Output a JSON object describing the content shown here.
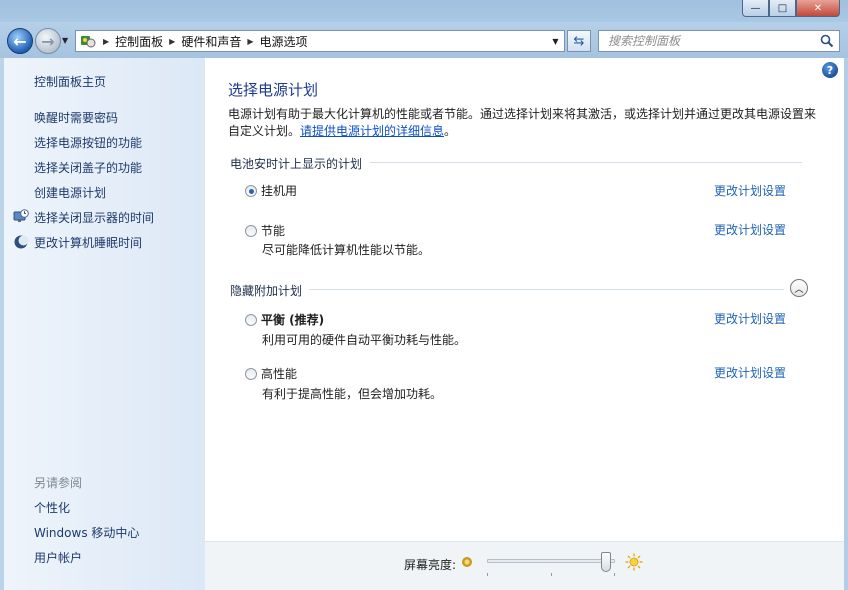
{
  "window": {
    "buttons": {
      "minimize": "—",
      "maximize": "□",
      "close": "✕"
    }
  },
  "nav": {
    "back": "←",
    "forward": "→",
    "breadcrumb": [
      "控制面板",
      "硬件和声音",
      "电源选项"
    ],
    "search_placeholder": "搜索控制面板"
  },
  "sidebar": {
    "home": "控制面板主页",
    "tasks": [
      {
        "label": "唤醒时需要密码",
        "icon": null
      },
      {
        "label": "选择电源按钮的功能",
        "icon": null
      },
      {
        "label": "选择关闭盖子的功能",
        "icon": null
      },
      {
        "label": "创建电源计划",
        "icon": null
      },
      {
        "label": "选择关闭显示器的时间",
        "icon": "monitor-clock-icon"
      },
      {
        "label": "更改计算机睡眠时间",
        "icon": "moon-icon"
      }
    ],
    "see_also_title": "另请参阅",
    "see_also": [
      "个性化",
      "Windows 移动中心",
      "用户帐户"
    ]
  },
  "main": {
    "help": "?",
    "title": "选择电源计划",
    "intro_text": "电源计划有助于最大化计算机的性能或者节能。通过选择计划来将其激活，或选择计划并通过更改其电源设置来自定义计划。",
    "intro_link": "请提供电源计划的详细信息",
    "intro_end": "。",
    "battery_group": "电池安时计上显示的计划",
    "hidden_group": "隐藏附加计划",
    "change_label": "更改计划设置",
    "plans": [
      {
        "name": "挂机用",
        "desc": "",
        "selected": true,
        "bold": false
      },
      {
        "name": "节能",
        "desc": "尽可能降低计算机性能以节能。",
        "selected": false,
        "bold": false
      },
      {
        "name": "平衡 (推荐)",
        "desc": "利用可用的硬件自动平衡功耗与性能。",
        "selected": false,
        "bold": true
      },
      {
        "name": "高性能",
        "desc": "有利于提高性能，但会增加功耗。",
        "selected": false,
        "bold": false
      }
    ]
  },
  "brightness": {
    "label": "屏幕亮度:",
    "level": 0.93
  }
}
